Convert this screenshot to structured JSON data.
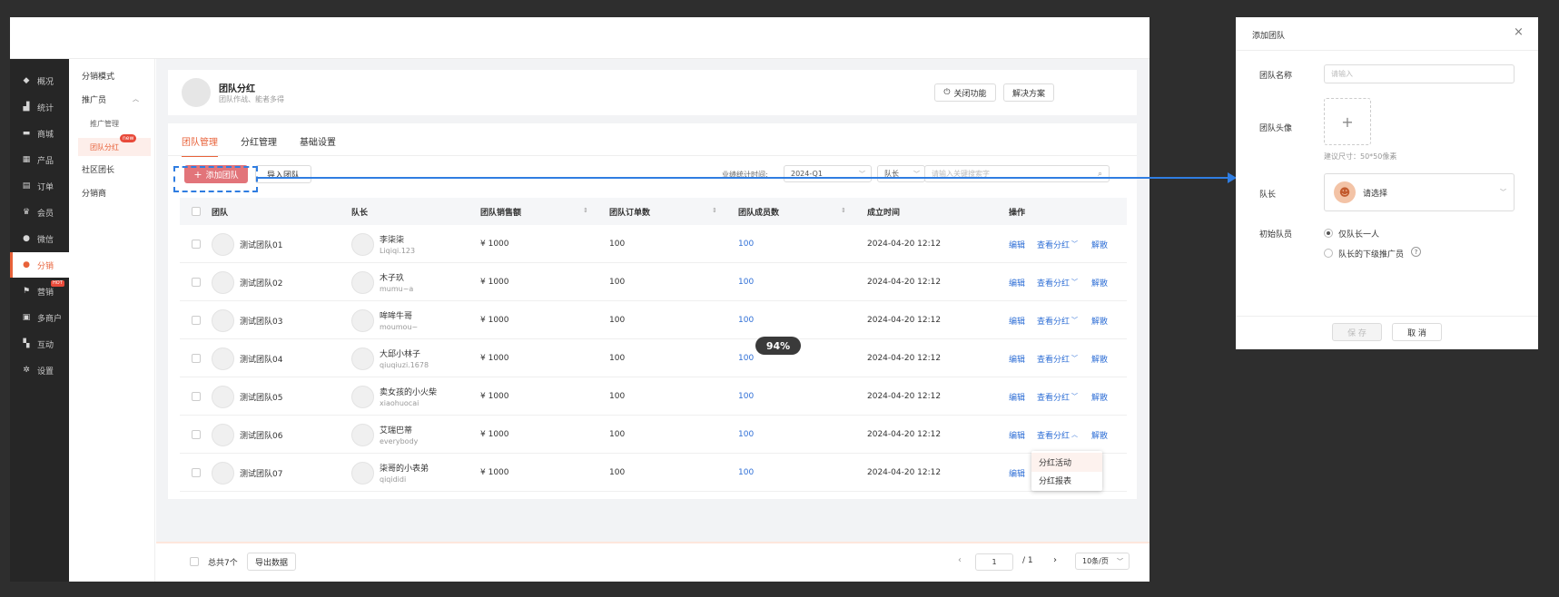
{
  "nav": {
    "items": [
      {
        "label": "概况",
        "icon": "layers-icon"
      },
      {
        "label": "统计",
        "icon": "chart-icon"
      },
      {
        "label": "商城",
        "icon": "store-icon"
      },
      {
        "label": "产品",
        "icon": "grid-icon"
      },
      {
        "label": "订单",
        "icon": "order-icon"
      },
      {
        "label": "会员",
        "icon": "crown-icon"
      },
      {
        "label": "微信",
        "icon": "wechat-icon"
      },
      {
        "label": "分销",
        "icon": "user-icon",
        "active": true
      },
      {
        "label": "营销",
        "icon": "flag-icon",
        "badge": "HOT"
      },
      {
        "label": "多商户",
        "icon": "merchant-icon"
      },
      {
        "label": "互动",
        "icon": "interact-icon"
      },
      {
        "label": "设置",
        "icon": "gear-icon"
      }
    ]
  },
  "subnav": {
    "mode": "分销模式",
    "promoter": "推广员",
    "promoter_mgmt": "推广管理",
    "team_bonus": "团队分红",
    "new_badge": "new",
    "community": "社区团长",
    "distributor": "分销商"
  },
  "header": {
    "title": "团队分红",
    "subtitle": "团队作战、能者多得",
    "close_btn": "关闭功能",
    "solution_btn": "解决方案"
  },
  "tabs": [
    "团队管理",
    "分红管理",
    "基础设置"
  ],
  "toolbar": {
    "add_btn": "添加团队",
    "import_btn": "导入团队",
    "stat_label": "业绩统计时间:",
    "stat_value": "2024-Q1",
    "filter_select": "队长",
    "search_placeholder": "请输入关键搜索字"
  },
  "table": {
    "headers": [
      "团队",
      "队长",
      "团队销售额",
      "团队订单数",
      "团队成员数",
      "成立时间",
      "操作"
    ],
    "rows": [
      {
        "team": "测试团队01",
        "leader": "李柒柒",
        "leader_id": "Liqiqi.123",
        "sales": "¥ 1000",
        "orders": "100",
        "members": "100",
        "date": "2024-04-20  12:12"
      },
      {
        "team": "测试团队02",
        "leader": "木子玖",
        "leader_id": "mumu~a",
        "sales": "¥ 1000",
        "orders": "100",
        "members": "100",
        "date": "2024-04-20  12:12"
      },
      {
        "team": "测试团队03",
        "leader": "哞哞牛哥",
        "leader_id": "moumou~",
        "sales": "¥ 1000",
        "orders": "100",
        "members": "100",
        "date": "2024-04-20  12:12"
      },
      {
        "team": "测试团队04",
        "leader": "大邱小林子",
        "leader_id": "qiuqiuzi.1678",
        "sales": "¥ 1000",
        "orders": "100",
        "members": "100",
        "date": "2024-04-20  12:12"
      },
      {
        "team": "测试团队05",
        "leader": "卖女孩的小火柴",
        "leader_id": "xiaohuocai",
        "sales": "¥ 1000",
        "orders": "100",
        "members": "100",
        "date": "2024-04-20  12:12"
      },
      {
        "team": "测试团队06",
        "leader": "艾瑞巴蒂",
        "leader_id": "everybody",
        "sales": "¥ 1000",
        "orders": "100",
        "members": "100",
        "date": "2024-04-20  12:12"
      },
      {
        "team": "测试团队07",
        "leader": "柒哥的小表弟",
        "leader_id": "qiqididi",
        "sales": "¥ 1000",
        "orders": "100",
        "members": "100",
        "date": "2024-04-20  12:12"
      }
    ],
    "ops": {
      "edit": "编辑",
      "view_bonus": "查看分红",
      "dissolve": "解散"
    },
    "dropdown": [
      "分红活动",
      "分红报表"
    ]
  },
  "zoom": "94%",
  "footer": {
    "total": "总共7个",
    "export_btn": "导出数据",
    "page": "1",
    "page_total": "/  1",
    "page_size": "10条/页"
  },
  "drawer": {
    "title": "添加团队",
    "name_label": "团队名称",
    "name_placeholder": "请输入",
    "avatar_label": "团队头像",
    "avatar_hint": "建议尺寸：50*50像素",
    "leader_label": "队长",
    "leader_placeholder": "请选择",
    "init_label": "初始队员",
    "opt_only": "仅队长一人",
    "opt_sub": "队长的下级推广员",
    "save_btn": "保 存",
    "cancel_btn": "取 消"
  },
  "colors": {
    "accent": "#e8623a",
    "link": "#2f6fd6",
    "nav_bg": "#262626",
    "arrow": "#2f7de1"
  }
}
